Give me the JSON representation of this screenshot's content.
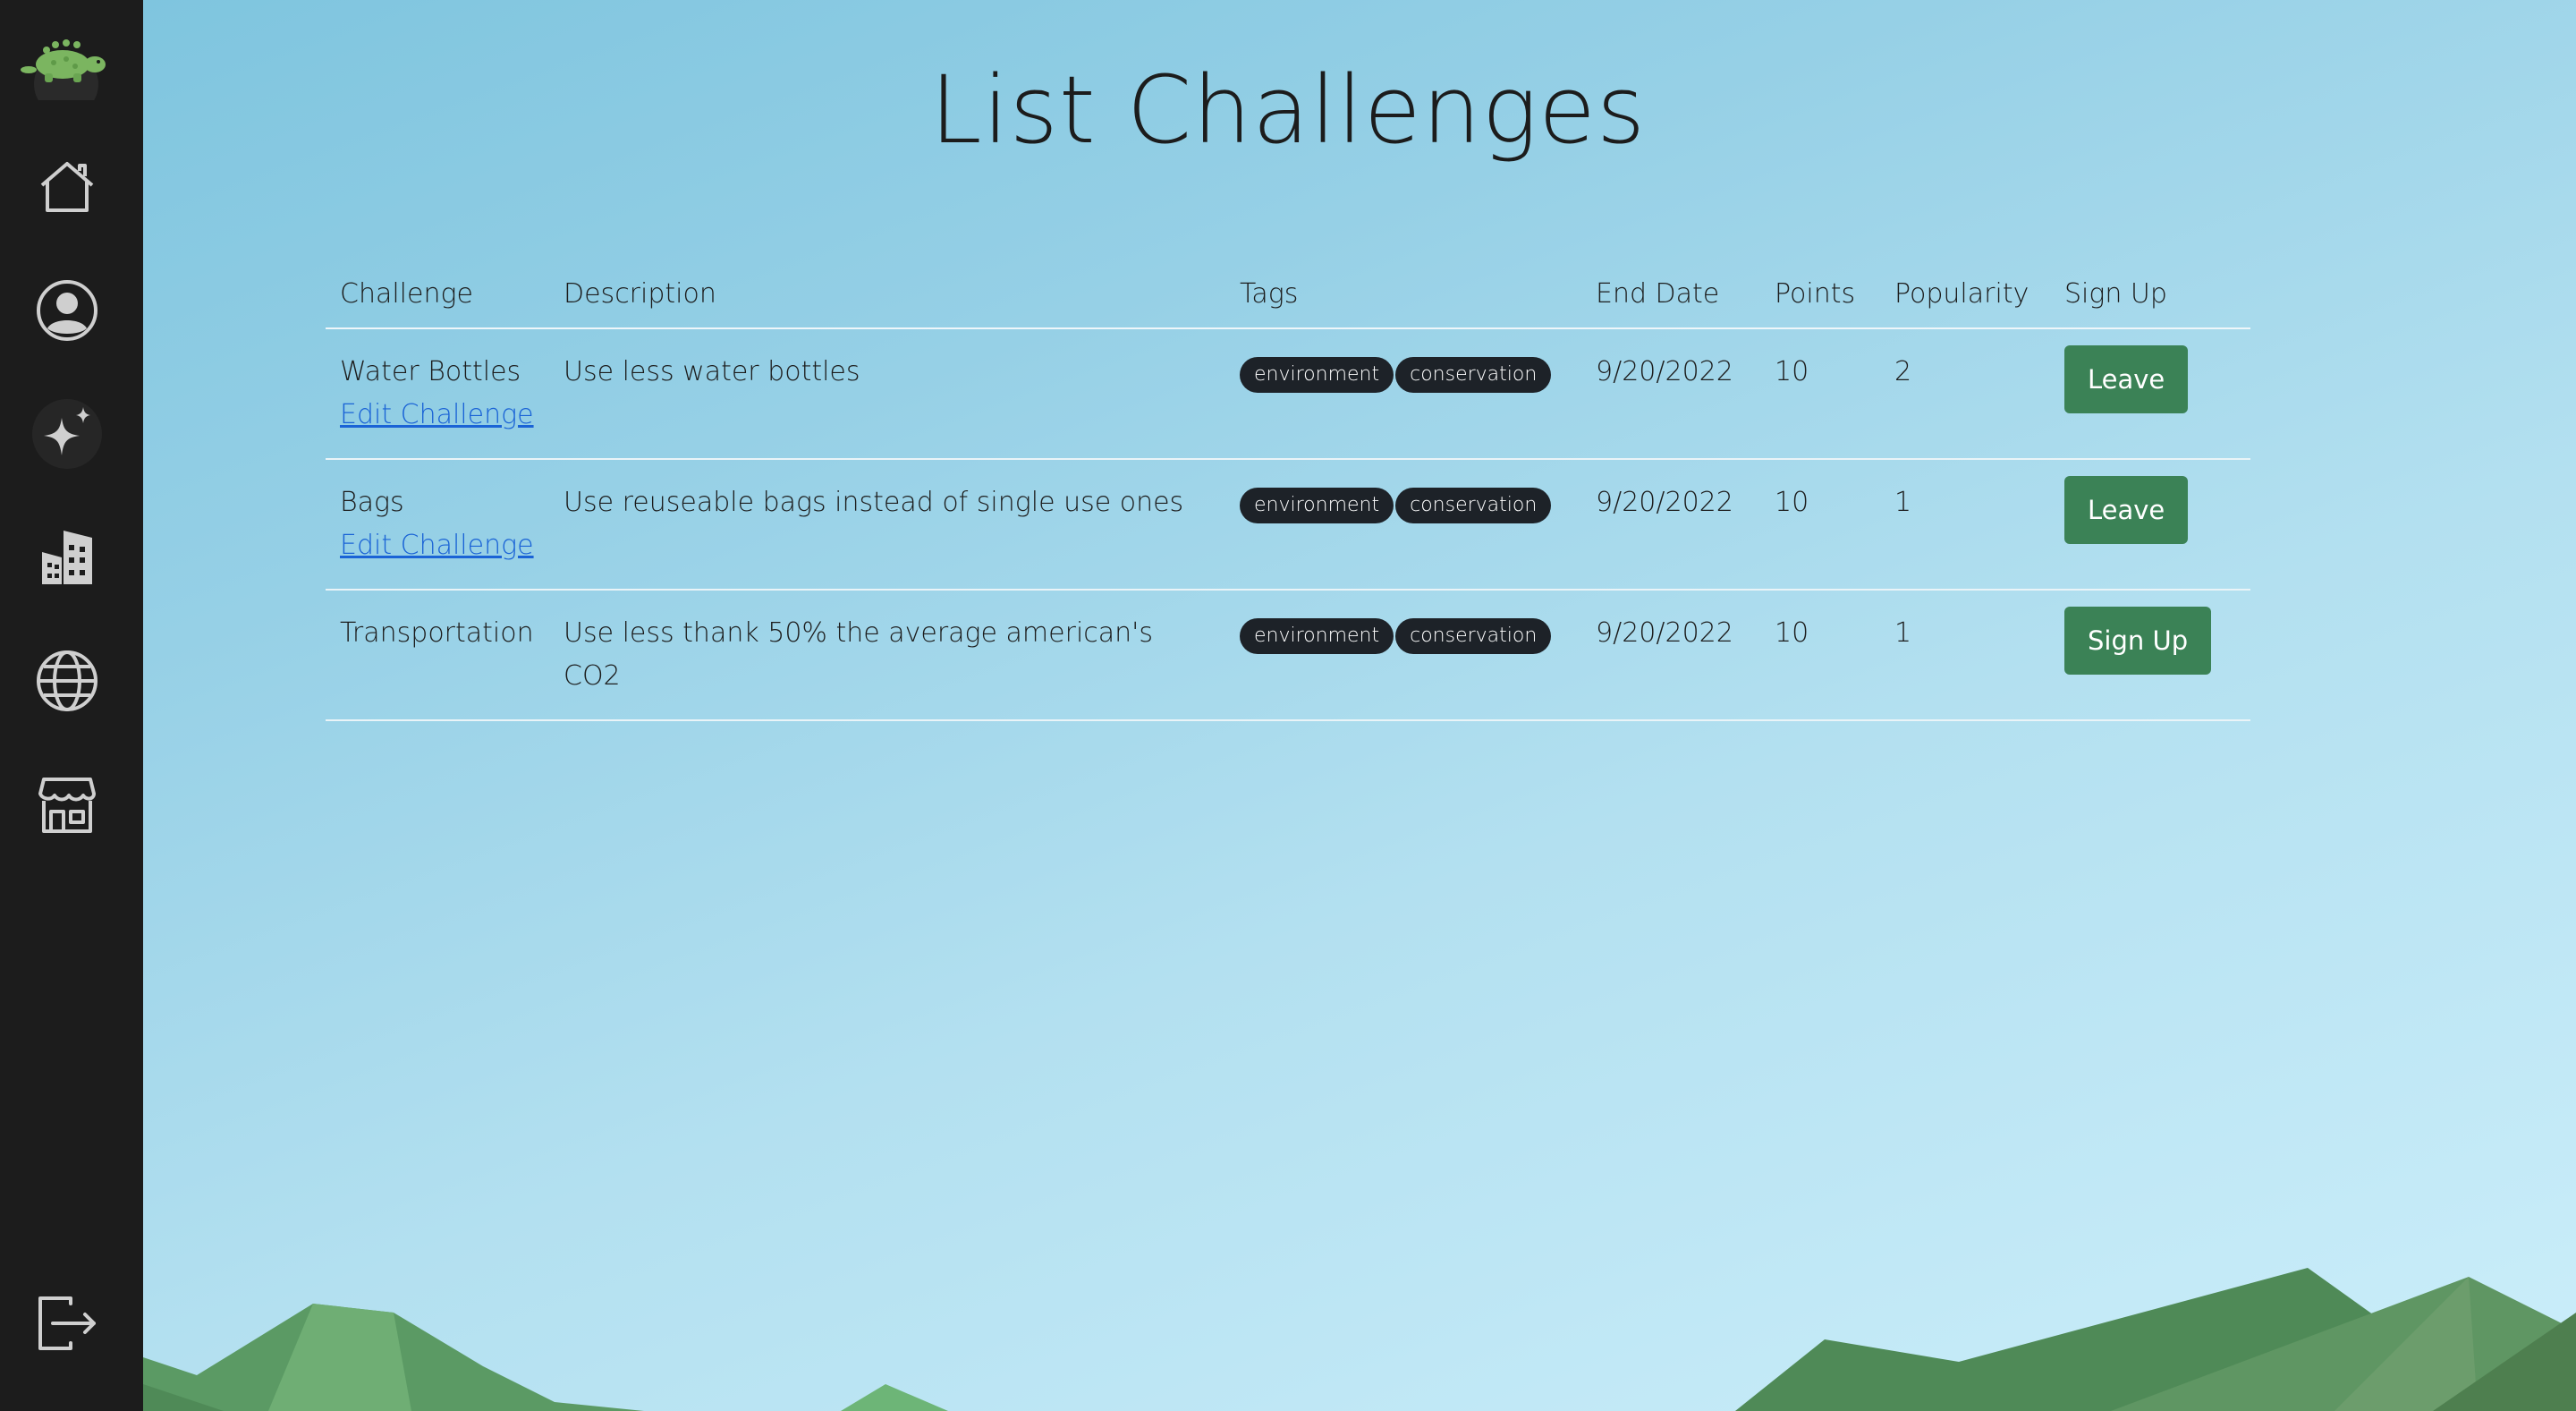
{
  "page": {
    "title": "List Challenges"
  },
  "sidebar": {
    "items": [
      {
        "icon": "home-icon"
      },
      {
        "icon": "profile-icon"
      },
      {
        "icon": "sparkles-icon"
      },
      {
        "icon": "buildings-icon"
      },
      {
        "icon": "globe-icon"
      },
      {
        "icon": "store-icon"
      }
    ],
    "logout_icon": "logout-icon"
  },
  "table": {
    "headers": [
      "Challenge",
      "Description",
      "Tags",
      "End Date",
      "Points",
      "Popularity",
      "Sign Up"
    ],
    "rows": [
      {
        "challenge": "Water Bottles",
        "edit_link": "Edit Challenge",
        "description": "Use less water bottles",
        "tags": [
          "environment",
          "conservation"
        ],
        "end_date": "9/20/2022",
        "points": "10",
        "popularity": "2",
        "action": "Leave"
      },
      {
        "challenge": "Bags",
        "edit_link": "Edit Challenge",
        "description": "Use reuseable bags instead of single use ones",
        "tags": [
          "environment",
          "conservation"
        ],
        "end_date": "9/20/2022",
        "points": "10",
        "popularity": "1",
        "action": "Leave"
      },
      {
        "challenge": "Transportation",
        "edit_link": "",
        "description": "Use less thank 50% the average american's CO2",
        "tags": [
          "environment",
          "conservation"
        ],
        "end_date": "9/20/2022",
        "points": "10",
        "popularity": "1",
        "action": "Sign Up"
      }
    ]
  },
  "colors": {
    "sidebar": "#1c1c1c",
    "button": "#3b8256",
    "tag": "#1d2228",
    "link": "#1a63d6"
  }
}
